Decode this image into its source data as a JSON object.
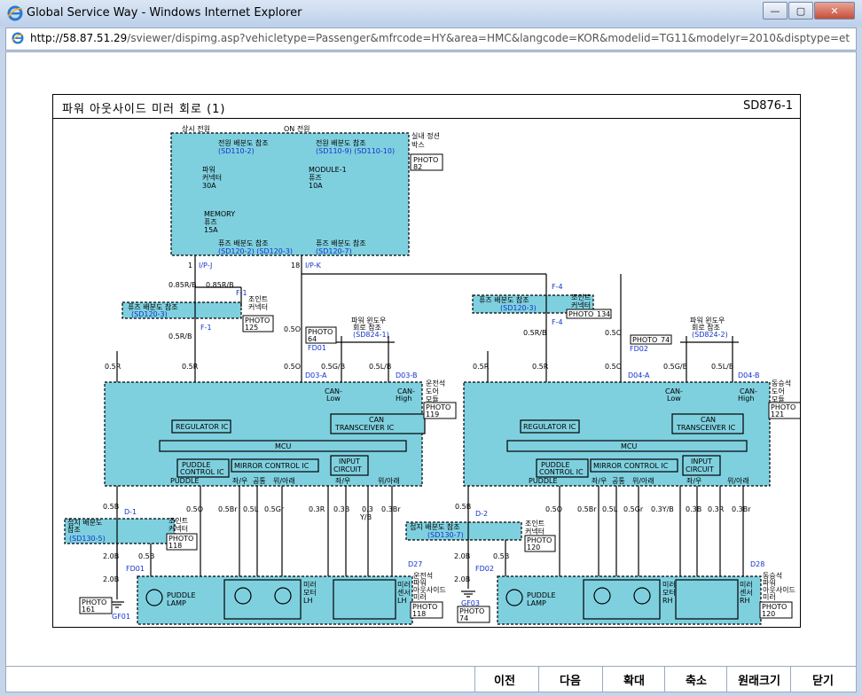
{
  "window": {
    "title": "Global Service Way - Windows Internet Explorer",
    "minimize_glyph": "—",
    "maximize_glyph": "▢",
    "close_glyph": "✕"
  },
  "address": {
    "host": "http://58.87.51.29",
    "path": "/sviewer/dispimg.asp?vehicletype=Passenger&mfrcode=HY&area=HMC&langcode=KOR&modelid=TG11&modelyr=2010&disptype=etm&imgpath=f"
  },
  "diagram": {
    "title": "파워 아웃사이드 미러 회로 (1)",
    "code": "SD876-1",
    "power_labels": {
      "always": "상시 전원",
      "on": "ON 전원"
    },
    "fuse_box": {
      "name_line1": "실내 정션",
      "name_line2": "박스",
      "photo": "PHOTO",
      "photo_num": "82"
    },
    "fuse_box_refs": {
      "top_left_line1": "전원 배분도 참조",
      "top_left_line2": "(SD110-2)",
      "top_right_line1": "전원 배분도 참조",
      "top_right_line2": "(SD110-9)  (SD110-10)",
      "bottom_left_line1": "퓨즈 배분도 참조",
      "bottom_left_line2": "(SD120-2)  (SD120-3)",
      "bottom_right_line1": "퓨즈 배분도 참조",
      "bottom_right_line2": "(SD120-7)"
    },
    "fuses": {
      "power_connector": [
        "파워",
        "커넥터",
        "30A"
      ],
      "memory": [
        "MEMORY",
        "퓨즈",
        "15A"
      ],
      "module": [
        "MODULE-1",
        "퓨즈",
        "10A"
      ]
    },
    "pins": {
      "ip_j_num": "1",
      "ip_j": "I/P-J",
      "ip_k_num": "18",
      "ip_k": "I/P-K",
      "f1": "F-1",
      "f4": "F-4",
      "d1": "D-1",
      "d2": "D-2",
      "fd01": "FD01",
      "fd02": "FD02",
      "d27": "D27",
      "d28": "D28",
      "d03a": "D03-A",
      "d03b": "D03-B",
      "d04a": "D04-A",
      "d04b": "D04-B"
    },
    "joint_connector": [
      "조인트",
      "커넥터"
    ],
    "fuse_ref_sd120_3": [
      "퓨즈 배분도 참조",
      "(SD120-3)"
    ],
    "ground_ref_sd130_5": [
      "접지 배분도",
      "참조",
      "(SD130-5)"
    ],
    "ground_ref_sd130_7": [
      "접지 배분도 참조",
      "(SD130-7)"
    ],
    "power_window_ref_left": [
      "파워 윈도우",
      "회로 참조",
      "(SD824-1)"
    ],
    "power_window_ref_right": [
      "파워 윈도우",
      "회로 참조",
      "(SD824-2)"
    ],
    "photos": {
      "p125": "125",
      "p134": "134",
      "p64": "64",
      "p74": "74",
      "p118": "118",
      "p120": "120",
      "p161": "161",
      "p119": "119",
      "p121": "121"
    },
    "grounds": {
      "gf01": "GF01",
      "gf03": "GF03"
    },
    "wires_left": {
      "w1": "0.85R/B",
      "w2": "0.85R/B",
      "w3": "0.5R/B",
      "w4": "0.5O",
      "w5": "0.5R",
      "w6": "0.5R",
      "w7": "0.5O",
      "w8": "0.5G/B",
      "w9": "0.5L/B",
      "w10": "0.5B",
      "w11": "0.5O",
      "w12": "0.5Br",
      "w13": "0.5L",
      "w14": "0.5Gr",
      "w15": "0.3R",
      "w16": "0.3B",
      "w17": "0.3",
      "w17b": "Y/B",
      "w18": "0.3Br",
      "w19": "2.0B",
      "w20": "2.0B",
      "w21": "0.5B"
    },
    "wires_right": {
      "w3": "0.5R/B",
      "w4": "0.5O",
      "w5": "0.5R",
      "w6": "0.5R",
      "w7": "0.5O",
      "w8": "0.5G/B",
      "w9": "0.5L/B",
      "w10": "0.5B",
      "w11": "0.5O",
      "w12": "0.5Br",
      "w13": "0.5L",
      "w14": "0.5Gr",
      "w15": "0.3Y/B",
      "w16": "0.3B",
      "w17": "0.3R",
      "w18": "0.3Br",
      "w19": "2.0B",
      "w20": "2.0B",
      "w21": "0.5B"
    },
    "module_left": {
      "name": [
        "운전석",
        "도어",
        "모듈"
      ]
    },
    "module_right": {
      "name": [
        "동승석",
        "도어",
        "모듈"
      ]
    },
    "module_parts": {
      "can_low": [
        "CAN-",
        "Low"
      ],
      "can_high": [
        "CAN-",
        "High"
      ],
      "regulator": "REGULATOR IC",
      "can_ic": [
        "CAN",
        "TRANSCEIVER IC"
      ],
      "mcu": "MCU",
      "puddle_ic": [
        "PUDDLE",
        "CONTROL IC"
      ],
      "mirror_ic": "MIRROR CONTROL IC",
      "input_circuit": [
        "INPUT",
        "CIRCUIT"
      ],
      "puddle": "PUDDLE",
      "sub_labels": [
        "좌/우",
        "공통",
        "위/아래",
        "좌/우",
        "위/아래"
      ]
    },
    "mirror_left": {
      "name": [
        "운전석",
        "파워",
        "아웃사이드",
        "미러"
      ],
      "motor": [
        "미러",
        "모터",
        "LH"
      ],
      "sensor": [
        "미러",
        "센서",
        "LH"
      ]
    },
    "mirror_right": {
      "name": [
        "동승석",
        "파워",
        "아웃사이드",
        "미러"
      ],
      "motor": [
        "미러",
        "모터",
        "RH"
      ],
      "sensor": [
        "미러",
        "센서",
        "RH"
      ]
    },
    "puddle_lamp": [
      "PUDDLE",
      "LAMP"
    ]
  },
  "buttons": {
    "prev": "이전",
    "next": "다음",
    "zoom_in": "확대",
    "zoom_out": "축소",
    "original": "원래크기",
    "close": "닫기"
  }
}
